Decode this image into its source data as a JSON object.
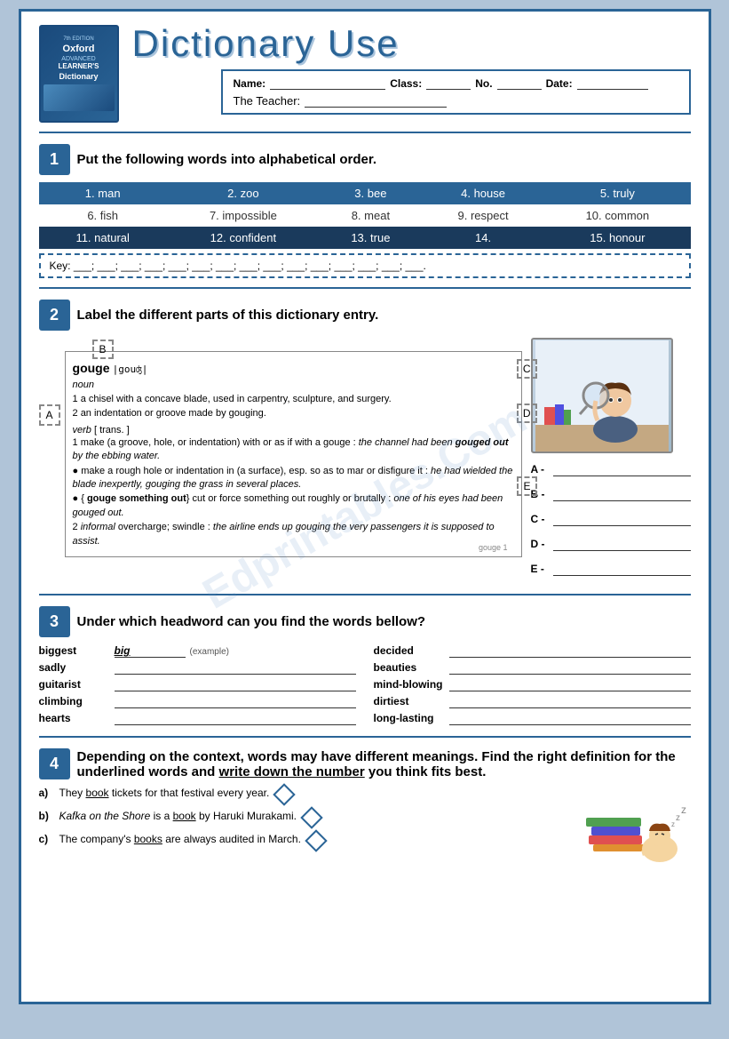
{
  "title": "Dictionary Use",
  "book": {
    "edition": "7th EDITION",
    "line1": "Oxford",
    "line2": "ADVANCED",
    "line3": "LEARNER'S",
    "line4": "Dictionary"
  },
  "form": {
    "name_label": "Name:",
    "class_label": "Class:",
    "no_label": "No.",
    "date_label": "Date:",
    "teacher_label": "The Teacher:"
  },
  "section1": {
    "number": "1",
    "instruction": "Put the following words into alphabetical order.",
    "words": [
      {
        "num": "1.",
        "word": "man"
      },
      {
        "num": "2.",
        "word": "zoo"
      },
      {
        "num": "3.",
        "word": "bee"
      },
      {
        "num": "4.",
        "word": "house"
      },
      {
        "num": "5.",
        "word": "truly"
      },
      {
        "num": "6.",
        "word": "fish"
      },
      {
        "num": "7.",
        "word": "impossible"
      },
      {
        "num": "8.",
        "word": "meat"
      },
      {
        "num": "9.",
        "word": "respect"
      },
      {
        "num": "10.",
        "word": "common"
      },
      {
        "num": "11.",
        "word": "natural"
      },
      {
        "num": "12.",
        "word": "confident"
      },
      {
        "num": "13.",
        "word": "true"
      },
      {
        "num": "14.",
        "word": ""
      },
      {
        "num": "15.",
        "word": "honour"
      }
    ],
    "key_label": "Key:",
    "key_blanks": "___; ___; ___; ___; ___; ___; ___; ___; ___; ___; ___; ___; ___; ___; ___."
  },
  "section2": {
    "number": "2",
    "instruction": "Label the different parts of this dictionary entry.",
    "labels": [
      "A",
      "B",
      "C",
      "D",
      "E"
    ],
    "entry_headword": "gouge",
    "entry_phonetic": "|gouʤ|",
    "entry_lines": [
      "noun",
      "1 a chisel with a concave blade, used in carpentry, sculpture, and surgery.",
      "2 an indentation or groove made by gouging.",
      "",
      "verb [ trans. ]",
      "1 make (a groove, hole, or indentation) with or as if with a gouge : the channel had been gouged out by the ebbing water.",
      "● make a rough hole or indentation in (a surface), esp. so as to mar or disfigure it : he had wielded the blade inexpertly, gouging the grass in several places.",
      "● { gouge something out} cut or force something out roughly or brutally : one of his eyes had been gouged out.",
      "2 informal overcharge; swindle : the airline ends up gouging the very passengers it is supposed to assist."
    ],
    "answer_labels": [
      "A -",
      "B -",
      "C -",
      "D -",
      "E -"
    ]
  },
  "section3": {
    "number": "3",
    "instruction": "Under which headword can you find the words bellow?",
    "items_left": [
      {
        "word": "biggest",
        "answer": "big",
        "is_example": true
      },
      {
        "word": "sadly",
        "answer": ""
      },
      {
        "word": "guitarist",
        "answer": ""
      },
      {
        "word": "climbing",
        "answer": ""
      },
      {
        "word": "hearts",
        "answer": ""
      }
    ],
    "items_right": [
      {
        "word": "decided",
        "answer": ""
      },
      {
        "word": "beauties",
        "answer": ""
      },
      {
        "word": "mind-blowing",
        "answer": ""
      },
      {
        "word": "dirtiest",
        "answer": ""
      },
      {
        "word": "long-lasting",
        "answer": ""
      }
    ]
  },
  "section4": {
    "number": "4",
    "instruction": "Depending on the context, words may have different meanings. Find the right definition for the underlined words and",
    "instruction2": "write down the number",
    "instruction3": "you think fits best.",
    "items": [
      {
        "letter": "a)",
        "text": "They book tickets for that festival every year.",
        "underlined": "book"
      },
      {
        "letter": "b)",
        "text_before": "",
        "italic_title": "Kafka on the Shore",
        "text_after": " is a book by Haruki Murakami.",
        "underlined": "book"
      },
      {
        "letter": "c)",
        "text": "The company's books are always audited in March.",
        "underlined": "books"
      }
    ]
  },
  "watermark": "Edprintables.Com"
}
